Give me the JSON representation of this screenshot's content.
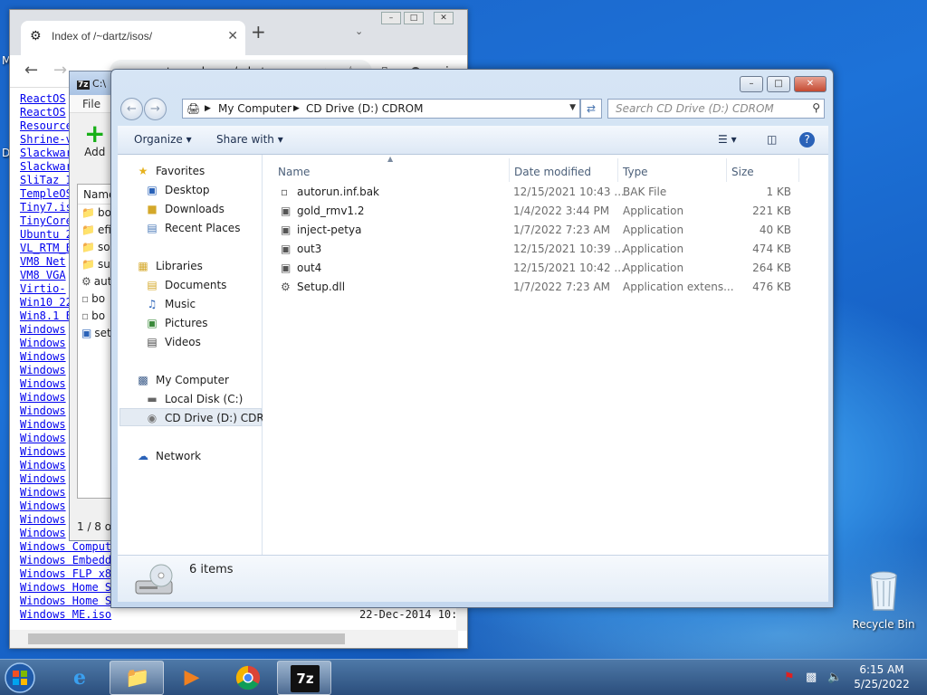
{
  "desktop": {
    "labels": [
      "M",
      "D"
    ],
    "recycle_bin": "Recycle Bin"
  },
  "chrome": {
    "tab_title": "Index of /~dartz/isos/",
    "url": "computernewb.com/~dartz",
    "files": [
      {
        "name": "ReactOS"
      },
      {
        "name": "ReactOS"
      },
      {
        "name": "Resource"
      },
      {
        "name": "Shrine-v"
      },
      {
        "name": "Slackwar"
      },
      {
        "name": "Slackwar"
      },
      {
        "name": "SliTaz I"
      },
      {
        "name": "TempleOS"
      },
      {
        "name": "Tiny7.is"
      },
      {
        "name": "TinyCore"
      },
      {
        "name": "Ubuntu 2"
      },
      {
        "name": "VL_RTM_E"
      },
      {
        "name": "VM8 Net"
      },
      {
        "name": "VM8 VGA"
      },
      {
        "name": "Virtio-"
      },
      {
        "name": "Win10 22"
      },
      {
        "name": "Win8.1 E"
      },
      {
        "name": "Windows"
      },
      {
        "name": "Windows"
      },
      {
        "name": "Windows"
      },
      {
        "name": "Windows"
      },
      {
        "name": "Windows"
      },
      {
        "name": "Windows"
      },
      {
        "name": "Windows"
      },
      {
        "name": "Windows"
      },
      {
        "name": "Windows"
      },
      {
        "name": "Windows"
      },
      {
        "name": "Windows"
      },
      {
        "name": "Windows"
      },
      {
        "name": "Windows"
      },
      {
        "name": "Windows"
      },
      {
        "name": "Windows"
      },
      {
        "name": "Windows"
      },
      {
        "name": "Windows Comput"
      },
      {
        "name": "Windows Embedd"
      },
      {
        "name": "Windows FLP x8"
      },
      {
        "name": "Windows Home S"
      },
      {
        "name": "Windows Home S"
      },
      {
        "name": "Windows ME.iso",
        "date": "22-Dec-2014 10:4"
      }
    ]
  },
  "sevenzip": {
    "title": "C:\\",
    "menu_file": "File",
    "add_label": "Add",
    "column_name": "Name",
    "items": [
      "bo",
      "efi",
      "sou",
      "sup",
      "aut",
      "bo",
      "bo",
      "set"
    ],
    "status": "1 / 8 ob"
  },
  "explorer": {
    "breadcrumb": [
      "My Computer",
      "CD Drive (D:) CDROM"
    ],
    "search_placeholder": "Search CD Drive (D:) CDROM",
    "organize": "Organize",
    "share_with": "Share with",
    "nav": {
      "favorites": "Favorites",
      "fav_items": [
        "Desktop",
        "Downloads",
        "Recent Places"
      ],
      "libraries": "Libraries",
      "lib_items": [
        "Documents",
        "Music",
        "Pictures",
        "Videos"
      ],
      "computer": "My Computer",
      "comp_items": [
        "Local Disk (C:)",
        "CD Drive (D:) CDROM"
      ],
      "network": "Network"
    },
    "columns": [
      "Name",
      "Date modified",
      "Type",
      "Size"
    ],
    "files": [
      {
        "name": "autorun.inf.bak",
        "date": "12/15/2021 10:43 ...",
        "type": "BAK File",
        "size": "1 KB"
      },
      {
        "name": "gold_rmv1.2",
        "date": "1/4/2022 3:44 PM",
        "type": "Application",
        "size": "221 KB"
      },
      {
        "name": "inject-petya",
        "date": "1/7/2022 7:23 AM",
        "type": "Application",
        "size": "40 KB"
      },
      {
        "name": "out3",
        "date": "12/15/2021 10:39 ...",
        "type": "Application",
        "size": "474 KB"
      },
      {
        "name": "out4",
        "date": "12/15/2021 10:42 ...",
        "type": "Application",
        "size": "264 KB"
      },
      {
        "name": "Setup.dll",
        "date": "1/7/2022 7:23 AM",
        "type": "Application extens...",
        "size": "476 KB"
      }
    ],
    "item_count": "6 items"
  },
  "taskbar": {
    "time": "6:15 AM",
    "date": "5/25/2022",
    "sevenzip_label": "7z"
  }
}
